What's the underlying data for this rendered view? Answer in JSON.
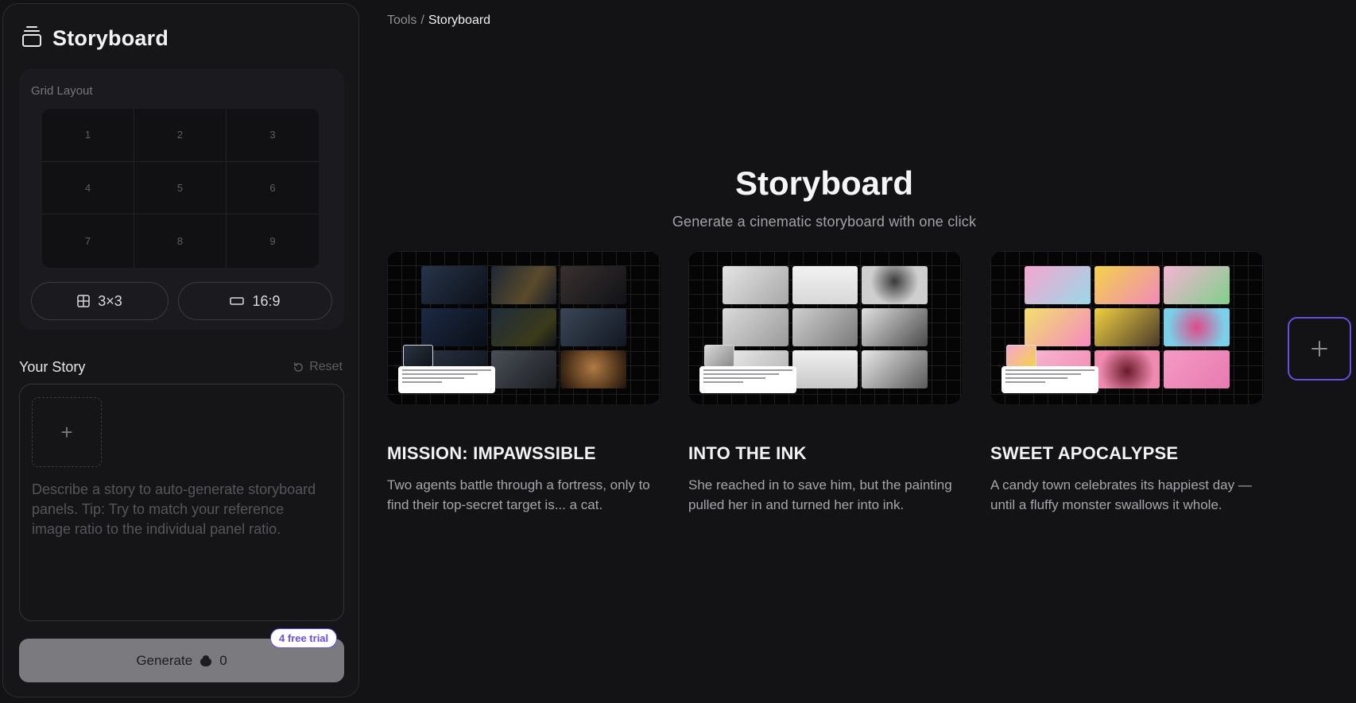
{
  "sidebar": {
    "title": "Storyboard",
    "grid_label": "Grid Layout",
    "cells": [
      "1",
      "2",
      "3",
      "4",
      "5",
      "6",
      "7",
      "8",
      "9"
    ],
    "grid_button": "3×3",
    "ratio_button": "16:9",
    "story_label": "Your Story",
    "reset_label": "Reset",
    "add_symbol": "+",
    "story_placeholder": "Describe a story to auto-generate storyboard panels. Tip: Try to match your reference image ratio to the individual panel ratio.",
    "generate_label": "Generate",
    "credit_count": "0",
    "trial_badge": "4 free trial"
  },
  "breadcrumb": {
    "parent": "Tools",
    "separator": "/",
    "current": "Storyboard"
  },
  "hero": {
    "title": "Storyboard",
    "subtitle": "Generate a cinematic storyboard with one click"
  },
  "cards": [
    {
      "title": "MISSION: IMPAWSSIBLE",
      "description": "Two agents battle through a fortress, only to find their top-secret target is... a cat."
    },
    {
      "title": "INTO THE INK",
      "description": "She reached in to save him, but the painting pulled her in and turned her into ink."
    },
    {
      "title": "SWEET APOCALYPSE",
      "description": "A candy town celebrates its happiest day — until a fluffy monster swallows it whole."
    }
  ],
  "colors": {
    "accent": "#6b4de6",
    "background": "#131316",
    "generate_bg": "#7a7a7f"
  }
}
